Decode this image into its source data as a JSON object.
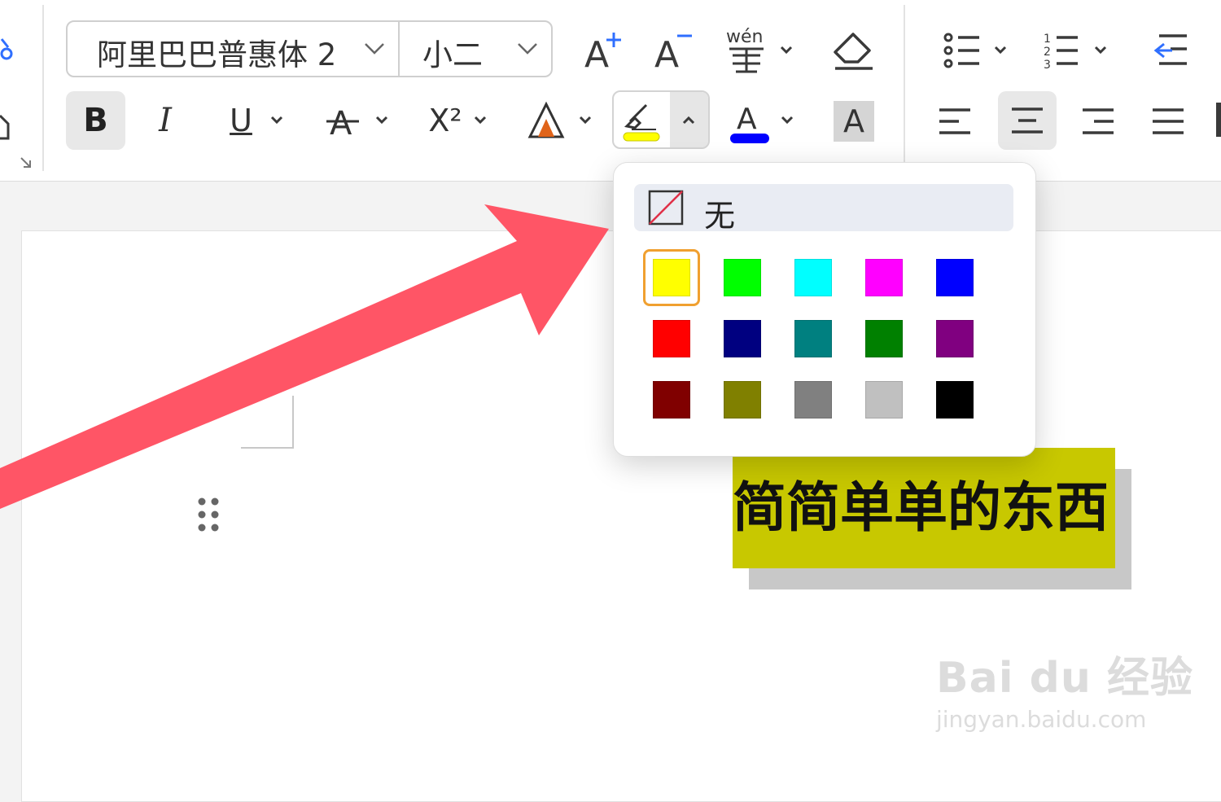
{
  "toolbar": {
    "font_name": "阿里巴巴普惠体 2",
    "font_size": "小二",
    "grow_font_icon": "A⁺",
    "shrink_font_icon": "A⁻",
    "phonetic_icon": "wén",
    "bold_label": "B",
    "italic_label": "I",
    "underline_label": "U",
    "superscript_label": "X²",
    "char_shading_label": "A"
  },
  "highlight_menu": {
    "none_label": "无",
    "swatches": [
      {
        "name": "yellow",
        "color": "#ffff00",
        "selected": true
      },
      {
        "name": "bright-green",
        "color": "#00ff00"
      },
      {
        "name": "cyan",
        "color": "#00ffff"
      },
      {
        "name": "magenta",
        "color": "#ff00ff"
      },
      {
        "name": "blue",
        "color": "#0000ff"
      },
      {
        "name": "red",
        "color": "#ff0000"
      },
      {
        "name": "navy",
        "color": "#000080"
      },
      {
        "name": "teal",
        "color": "#008080"
      },
      {
        "name": "green",
        "color": "#008000"
      },
      {
        "name": "purple",
        "color": "#800080"
      },
      {
        "name": "dark-red",
        "color": "#800000"
      },
      {
        "name": "olive",
        "color": "#808000"
      },
      {
        "name": "gray",
        "color": "#808080"
      },
      {
        "name": "light-gray",
        "color": "#c0c0c0"
      },
      {
        "name": "black",
        "color": "#000000"
      }
    ]
  },
  "document": {
    "text": "简简单单的东西"
  },
  "watermark": {
    "brand": "Bai du 经验",
    "url": "jingyan.baidu.com"
  },
  "colors": {
    "highlight_yellow": "#ffff00",
    "font_color_blue": "#0000ff",
    "arrow_red": "#ff5566",
    "accent_blue": "#2f6fff",
    "text_background": "#c8c800"
  },
  "icons": [
    "link-icon",
    "format-painter-icon",
    "dialog-launcher-icon",
    "grow-font-icon",
    "shrink-font-icon",
    "phonetic-guide-icon",
    "clear-format-icon",
    "bullet-list-icon",
    "numbered-list-icon",
    "decrease-indent-icon",
    "bold-icon",
    "italic-icon",
    "underline-icon",
    "strikethrough-icon",
    "superscript-icon",
    "text-effect-icon",
    "highlight-icon",
    "font-color-icon",
    "char-shading-icon",
    "align-left-icon",
    "align-center-icon",
    "align-right-icon",
    "justify-icon",
    "no-color-icon",
    "drag-handle-icon"
  ]
}
